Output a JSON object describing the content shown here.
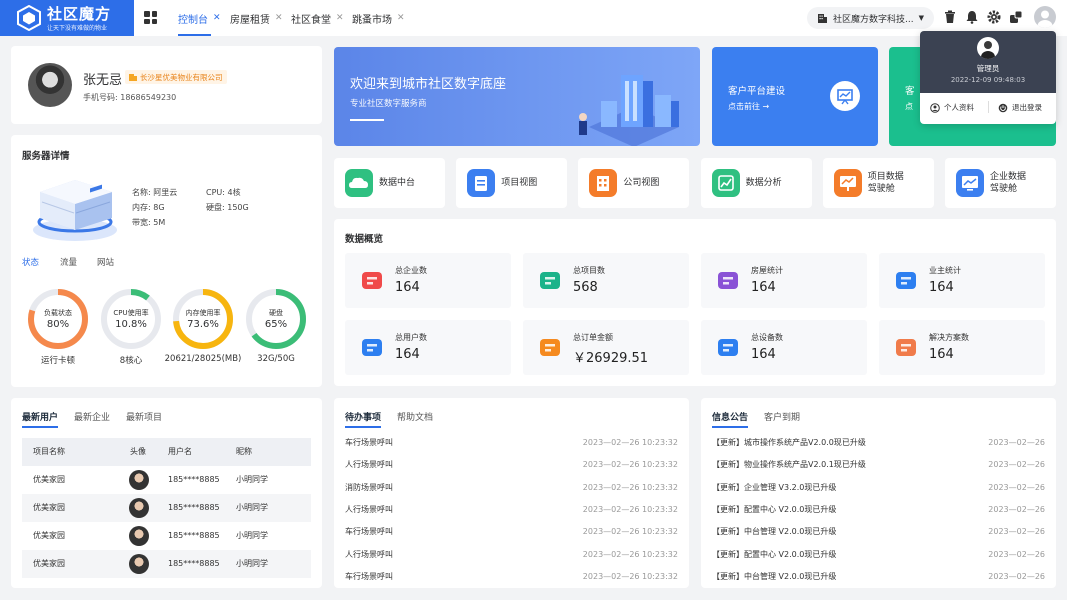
{
  "brand": {
    "name": "社区魔方",
    "slogan": "让天下没有难做的物业"
  },
  "tabs": [
    {
      "label": "控制台",
      "active": true
    },
    {
      "label": "房屋租赁"
    },
    {
      "label": "社区食堂"
    },
    {
      "label": "跳蚤市场"
    }
  ],
  "header": {
    "org": "社区魔方数字科技..."
  },
  "user_popup": {
    "role": "管理员",
    "time": "2022-12-09 09:48:03",
    "profile": "个人资料",
    "logout": "退出登录"
  },
  "profile": {
    "name": "张无忌",
    "company": "长沙星优美物业有限公司",
    "phone_label": "手机号码:",
    "phone": "18686549230"
  },
  "server": {
    "title": "服务器详情",
    "specs": [
      {
        "k": "名称:",
        "v": "阿里云"
      },
      {
        "k": "CPU:",
        "v": "4核"
      },
      {
        "k": "内存:",
        "v": "8G"
      },
      {
        "k": "硬盘:",
        "v": "150G"
      },
      {
        "k": "带宽:",
        "v": "5M"
      }
    ],
    "tabs": [
      "状态",
      "流量",
      "网站"
    ],
    "rings": [
      {
        "label": "负载状态",
        "value": "80%",
        "sub": "运行卡顿",
        "pct": 0.8,
        "color": "#f5894c"
      },
      {
        "label": "CPU使用率",
        "value": "10.8%",
        "sub": "8核心",
        "pct": 0.108,
        "color": "#3bbd77"
      },
      {
        "label": "内存使用率",
        "value": "73.6%",
        "sub": "20621/28025(MB)",
        "pct": 0.736,
        "color": "#f7b50f"
      },
      {
        "label": "硬盘",
        "value": "65%",
        "sub": "32G/50G",
        "pct": 0.65,
        "color": "#3bbd77"
      }
    ]
  },
  "banner": {
    "title": "欢迎来到城市社区数字底座",
    "sub": "专业社区数字服务商"
  },
  "card2": {
    "title": "客户平台建设",
    "link": "点击前往 →"
  },
  "card3": {
    "title": "客",
    "link": "点"
  },
  "quick": [
    {
      "label": "数据中台",
      "color": "#2fc081"
    },
    {
      "label": "项目视图",
      "color": "#3c7ff0"
    },
    {
      "label": "公司视图",
      "color": "#f47c2a"
    },
    {
      "label": "数据分析",
      "color": "#2fc081"
    },
    {
      "label": "项目数据\n驾驶舱",
      "color": "#f47c2a"
    },
    {
      "label": "企业数据\n驾驶舱",
      "color": "#3c7ff0"
    }
  ],
  "overview": {
    "title": "数据概览",
    "stats": [
      {
        "label": "总企业数",
        "value": "164",
        "color": "#f04a4a",
        "icon": "building-icon"
      },
      {
        "label": "总项目数",
        "value": "568",
        "color": "#1bb38a",
        "icon": "folder-icon"
      },
      {
        "label": "房屋统计",
        "value": "164",
        "color": "#8a52d6",
        "icon": "house-icon"
      },
      {
        "label": "业主统计",
        "value": "164",
        "color": "#2d7ff0",
        "icon": "person-icon"
      },
      {
        "label": "总用户数",
        "value": "164",
        "color": "#2d7ff0",
        "icon": "users-icon"
      },
      {
        "label": "总订单金额",
        "value": "￥26929.51",
        "color": "#f58a1f",
        "icon": "yen-icon"
      },
      {
        "label": "总设备数",
        "value": "164",
        "color": "#2d7ff0",
        "icon": "device-icon"
      },
      {
        "label": "解决方案数",
        "value": "164",
        "color": "#f07b4a",
        "icon": "solution-icon"
      }
    ]
  },
  "users_panel": {
    "tabs": [
      "最新用户",
      "最新企业",
      "最新项目"
    ],
    "headers": [
      "项目名称",
      "头像",
      "用户名",
      "昵称"
    ],
    "rows": [
      {
        "project": "优美家园",
        "user": "185****8885",
        "nick": "小明同学"
      },
      {
        "project": "优美家园",
        "user": "185****8885",
        "nick": "小明同学"
      },
      {
        "project": "优美家园",
        "user": "185****8885",
        "nick": "小明同学"
      },
      {
        "project": "优美家园",
        "user": "185****8885",
        "nick": "小明同学"
      }
    ]
  },
  "todo": {
    "tabs": [
      "待办事项",
      "帮助文档"
    ],
    "items": [
      {
        "t": "车行场景呼叫",
        "d": "2023—02—26 10:23:32"
      },
      {
        "t": "人行场景呼叫",
        "d": "2023—02—26 10:23:32"
      },
      {
        "t": "消防场景呼叫",
        "d": "2023—02—26 10:23:32"
      },
      {
        "t": "人行场景呼叫",
        "d": "2023—02—26 10:23:32"
      },
      {
        "t": "车行场景呼叫",
        "d": "2023—02—26 10:23:32"
      },
      {
        "t": "人行场景呼叫",
        "d": "2023—02—26 10:23:32"
      },
      {
        "t": "车行场景呼叫",
        "d": "2023—02—26 10:23:32"
      }
    ]
  },
  "notice": {
    "tabs": [
      "信息公告",
      "客户到期"
    ],
    "items": [
      {
        "t": "【更新】城市操作系统产品V2.0.0现已升级",
        "d": "2023—02—26"
      },
      {
        "t": "【更新】物业操作系统产品V2.0.1现已升级",
        "d": "2023—02—26"
      },
      {
        "t": "【更新】企业管理 V3.2.0现已升级",
        "d": "2023—02—26"
      },
      {
        "t": "【更新】配置中心 V2.0.0现已升级",
        "d": "2023—02—26"
      },
      {
        "t": "【更新】中台管理 V2.0.0现已升级",
        "d": "2023—02—26"
      },
      {
        "t": "【更新】配置中心 V2.0.0现已升级",
        "d": "2023—02—26"
      },
      {
        "t": "【更新】中台管理 V2.0.0现已升级",
        "d": "2023—02—26"
      }
    ]
  }
}
